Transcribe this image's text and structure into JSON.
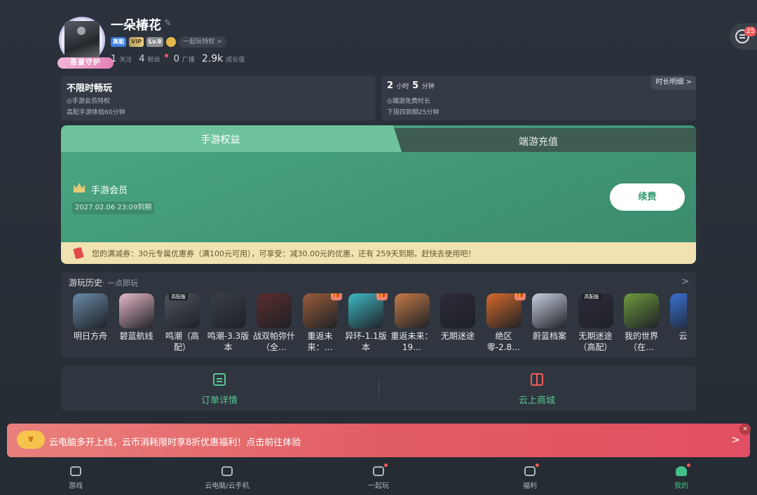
{
  "profile": {
    "nickname": "一朵椿花",
    "guard_label": "吾皇守护",
    "badges": {
      "hd": "高能",
      "vip": "VIP",
      "level": "Lv.8",
      "play_together": "一起玩特权 >"
    },
    "stats": [
      {
        "num": "1",
        "label": "关注"
      },
      {
        "num": "4",
        "label": "粉丝"
      },
      {
        "num": "0",
        "label": "广播"
      },
      {
        "num": "2.9k",
        "label": "成长值"
      }
    ]
  },
  "messages": {
    "count": "25"
  },
  "time_cards": {
    "left": {
      "title": "不限时畅玩",
      "line1": "◎手游会员特权",
      "line2": "高配手游体验60分钟"
    },
    "right": {
      "hours": "2",
      "hours_unit": "小时",
      "minutes": "5",
      "minutes_unit": "分钟",
      "line1": "◎端游免费时长",
      "line2": "下周四到期25分钟",
      "detail_tag": "时长明细 >"
    }
  },
  "tabs": {
    "active": "手游权益",
    "inactive": "端游充值"
  },
  "membership": {
    "title": "手游会员",
    "expire": "2027.02.06 23:09到期",
    "renew_label": "续费"
  },
  "coupon": {
    "text": "您的满减券：30元专属优惠券（满100元可用），可享受：减30.00元的优惠，还有 259天到期，赶快去使用吧！"
  },
  "history": {
    "title": "游玩历史",
    "subtitle": "· 一点即玩",
    "arrow": ">",
    "games": [
      {
        "name": "明日方舟",
        "color": "#6a8aa8",
        "gift": false,
        "hd": false
      },
      {
        "name": "碧蓝航线",
        "color": "#e8b9c9",
        "gift": false,
        "hd": false
      },
      {
        "name": "鸣潮（高配）",
        "color": "#50545c",
        "gift": false,
        "hd": true,
        "hd_label": "高配版"
      },
      {
        "name": "鸣潮-3.3版本",
        "color": "#3b3f46",
        "gift": false,
        "hd": false
      },
      {
        "name": "战双帕弥什（全…",
        "color": "#5b2d2d",
        "gift": false,
        "hd": false
      },
      {
        "name": "重返未来：…",
        "color": "#9a5d3a",
        "gift": true,
        "hd": false
      },
      {
        "name": "异环-1.1版本",
        "color": "#3fb9c4",
        "gift": true,
        "hd": false
      },
      {
        "name": "重返未来：19…",
        "color": "#c47a47",
        "gift": false,
        "hd": false
      },
      {
        "name": "无期迷途",
        "color": "#2d2a3a",
        "gift": false,
        "hd": false
      },
      {
        "name": "绝区零-2.8…",
        "color": "#d66a2a",
        "gift": true,
        "hd": false
      },
      {
        "name": "蔚蓝档案",
        "color": "#c7cfe0",
        "gift": false,
        "hd": false
      },
      {
        "name": "无期迷途（高配）",
        "color": "#2f2c3d",
        "gift": false,
        "hd": true,
        "hd_label": "高配版"
      },
      {
        "name": "我的世界（在…",
        "color": "#6f9a3e",
        "gift": false,
        "hd": false
      },
      {
        "name": "云手",
        "color": "#3a6fd0",
        "gift": false,
        "hd": false
      }
    ]
  },
  "shortcuts": {
    "orders": "订单详情",
    "mall": "云上商城"
  },
  "promo": {
    "cloud_label": "¥",
    "text": "云电脑多开上线，云币消耗限时享8折优惠福利！点击前往体验",
    "arrow": ">",
    "close": "×"
  },
  "bottom_nav": [
    {
      "label": "游戏",
      "dot": false,
      "active": false
    },
    {
      "label": "云电脑/云手机",
      "dot": false,
      "active": false
    },
    {
      "label": "一起玩",
      "dot": true,
      "active": false
    },
    {
      "label": "福利",
      "dot": true,
      "active": false
    },
    {
      "label": "我的",
      "dot": true,
      "active": true
    }
  ],
  "colors": {
    "accent": "#45c08a",
    "promo": "#e25d63",
    "panel_green": "#4ca882"
  }
}
